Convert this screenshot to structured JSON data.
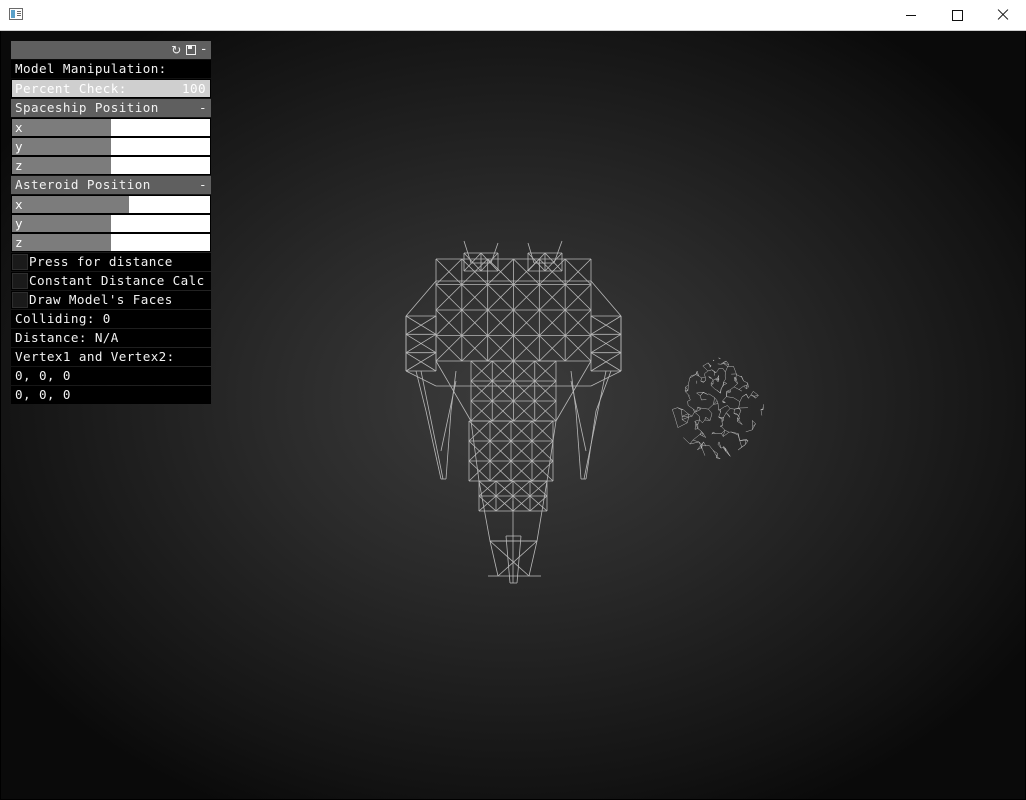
{
  "window": {
    "title": "",
    "controls": {
      "minimize": "minimize-icon",
      "maximize": "maximize-icon",
      "close": "close-icon"
    }
  },
  "gui": {
    "header_icons": [
      "refresh-icon",
      "save-icon",
      "collapse-icon"
    ],
    "model_manipulation_label": "Model Manipulation:",
    "percent_check": {
      "label": "Percent Check:",
      "value": "100",
      "fill_fraction": 1.0
    },
    "spaceship_position": {
      "title": "Spaceship Position",
      "collapse": "-",
      "fields": [
        {
          "label": "x",
          "fill_fraction": 0.5
        },
        {
          "label": "y",
          "fill_fraction": 0.5
        },
        {
          "label": "z",
          "fill_fraction": 0.5
        }
      ]
    },
    "asteroid_position": {
      "title": "Asteroid Position",
      "collapse": "-",
      "fields": [
        {
          "label": "x",
          "fill_fraction": 0.59
        },
        {
          "label": "y",
          "fill_fraction": 0.5
        },
        {
          "label": "z",
          "fill_fraction": 0.5
        }
      ]
    },
    "toggles": [
      {
        "label": "Press for distance",
        "checked": false
      },
      {
        "label": "Constant Distance Calc",
        "checked": false
      },
      {
        "label": "Draw Model's Faces",
        "checked": false
      }
    ],
    "colliding": "Colliding: 0",
    "distance": "Distance: N/A",
    "vertex_label": "Vertex1 and Vertex2:",
    "vertex1": "0, 0, 0",
    "vertex2": "0, 0, 0"
  },
  "colors": {
    "background_center": "#3c3c3c",
    "background_edge": "#0a0a0a",
    "wireframe": "#b4b4b4",
    "panel_header": "#5f5f5f"
  }
}
